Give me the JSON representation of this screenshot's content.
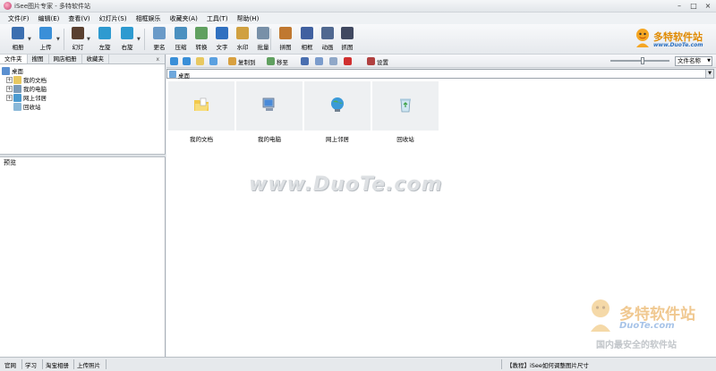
{
  "window": {
    "title": "iSee图片专家 - 多特软件站",
    "controls": [
      "–",
      "□",
      "×"
    ]
  },
  "menu": [
    "文件(F)",
    "编辑(E)",
    "查看(V)",
    "幻灯片(S)",
    "相框娱乐",
    "收藏夹(A)",
    "工具(T)",
    "帮助(H)"
  ],
  "toolbar": {
    "buttons": [
      {
        "label": "相册",
        "icon": "album-icon",
        "color": "#3c6fb0"
      },
      {
        "label": "上传",
        "icon": "upload-icon",
        "color": "#3a8fd8"
      },
      {
        "label": "幻灯",
        "icon": "slideshow-icon",
        "color": "#5a4030"
      },
      {
        "label": "左旋",
        "icon": "rotate-left-icon",
        "color": "#2e9ad0"
      },
      {
        "label": "右旋",
        "icon": "rotate-right-icon",
        "color": "#2e9ad0"
      },
      {
        "label": "更名",
        "icon": "rename-icon",
        "color": "#6a9ac8"
      },
      {
        "label": "压缩",
        "icon": "compress-icon",
        "color": "#4a90c0"
      },
      {
        "label": "转换",
        "icon": "convert-icon",
        "color": "#60a060"
      },
      {
        "label": "文字",
        "icon": "text-icon",
        "color": "#3070c0"
      },
      {
        "label": "水印",
        "icon": "watermark-icon",
        "color": "#d0a040"
      },
      {
        "label": "批量",
        "icon": "batch-icon",
        "color": "#7890a8"
      },
      {
        "label": "拼图",
        "icon": "collage-icon",
        "color": "#c07830"
      },
      {
        "label": "相框",
        "icon": "frame-icon",
        "color": "#4060a0"
      },
      {
        "label": "动画",
        "icon": "animation-icon",
        "color": "#506890"
      },
      {
        "label": "抓图",
        "icon": "capture-icon",
        "color": "#404860"
      }
    ]
  },
  "logo": {
    "title": "多特软件站",
    "domain": "www.DuoTe.com"
  },
  "left_tabs": {
    "items": [
      "文件夹",
      "搜图",
      "网店相册",
      "收藏夹"
    ],
    "close": "x"
  },
  "tree": [
    {
      "label": "桌面",
      "color": "#5a8fd0",
      "expander": "",
      "indent": 0
    },
    {
      "label": "我的文档",
      "color": "#e8c860",
      "expander": "+",
      "indent": 1
    },
    {
      "label": "我的电脑",
      "color": "#7a9ab8",
      "expander": "+",
      "indent": 1
    },
    {
      "label": "网上邻居",
      "color": "#4a9ad0",
      "expander": "+",
      "indent": 1
    },
    {
      "label": "回收站",
      "color": "#8ab8d8",
      "expander": "",
      "indent": 1
    }
  ],
  "preview": {
    "label": "预览"
  },
  "main_toolbar": {
    "copy_to": "复制到",
    "move_to": "移至",
    "settings": "设置",
    "sort": "文件名称"
  },
  "path": {
    "current": "桌面"
  },
  "items": [
    {
      "name": "我的文档",
      "icon": "documents-folder-icon"
    },
    {
      "name": "我的电脑",
      "icon": "computer-icon"
    },
    {
      "name": "网上邻居",
      "icon": "network-icon"
    },
    {
      "name": "回收站",
      "icon": "recycle-bin-icon"
    }
  ],
  "watermark": "www.DuoTe.com",
  "watermark_logo": {
    "title": "多特软件站",
    "domain": "DuoTe.com",
    "slogan": "国内最安全的软件站"
  },
  "status": {
    "links": [
      "官网",
      "学习",
      "淘宝相册",
      "上传照片"
    ],
    "tip": "【教程】iSee如何调整图片尺寸"
  }
}
